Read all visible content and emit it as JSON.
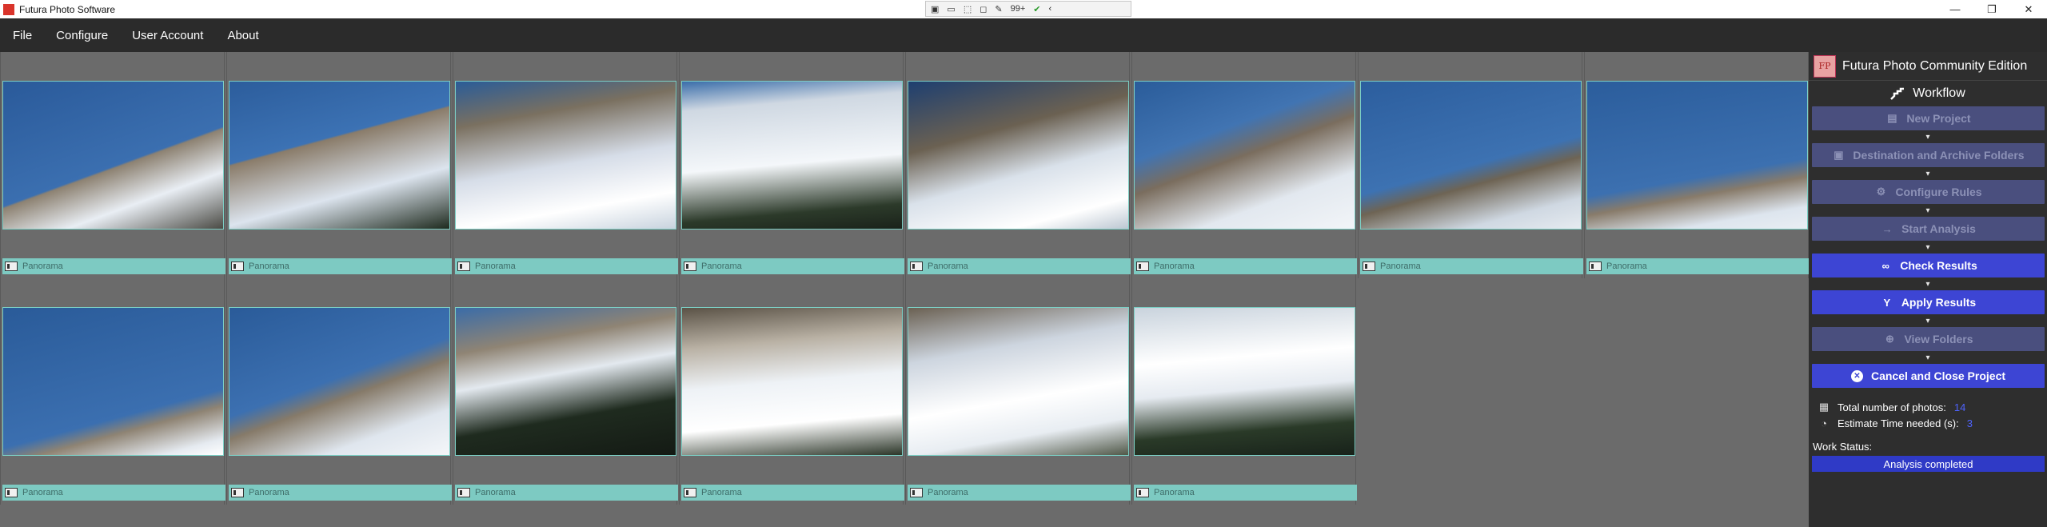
{
  "window": {
    "title": "Futura Photo Software"
  },
  "capture_toolbar": {
    "badge": "99+"
  },
  "menu": [
    "File",
    "Configure",
    "User Account",
    "About"
  ],
  "photos": [
    {
      "label": "Panorama"
    },
    {
      "label": "Panorama"
    },
    {
      "label": "Panorama"
    },
    {
      "label": "Panorama"
    },
    {
      "label": "Panorama"
    },
    {
      "label": "Panorama"
    },
    {
      "label": "Panorama"
    },
    {
      "label": "Panorama"
    },
    {
      "label": "Panorama"
    },
    {
      "label": "Panorama"
    },
    {
      "label": "Panorama"
    },
    {
      "label": "Panorama"
    },
    {
      "label": "Panorama"
    },
    {
      "label": "Panorama"
    }
  ],
  "panel": {
    "brand_logo": "FP",
    "brand_title": "Futura Photo Community Edition",
    "workflow_title": "Workflow",
    "steps": [
      {
        "label": "New Project",
        "state": "disabled",
        "icon": "new-project-icon"
      },
      {
        "label": "Destination and Archive Folders",
        "state": "disabled",
        "icon": "folders-icon"
      },
      {
        "label": "Configure Rules",
        "state": "disabled",
        "icon": "gears-icon"
      },
      {
        "label": "Start Analysis",
        "state": "disabled",
        "icon": "arrow-right-icon"
      },
      {
        "label": "Check Results",
        "state": "enabled",
        "icon": "binoculars-icon"
      },
      {
        "label": "Apply Results",
        "state": "enabled",
        "icon": "apply-icon"
      },
      {
        "label": "View Folders",
        "state": "disabled",
        "icon": "view-icon"
      },
      {
        "label": "Cancel and Close Project",
        "state": "enabled",
        "icon": "cancel-icon"
      }
    ],
    "stats": {
      "total_label": "Total number of photos:",
      "total_value": "14",
      "time_label": "Estimate Time needed (s):",
      "time_value": "3"
    },
    "work_status_label": "Work Status:",
    "work_status_value": "Analysis completed"
  }
}
